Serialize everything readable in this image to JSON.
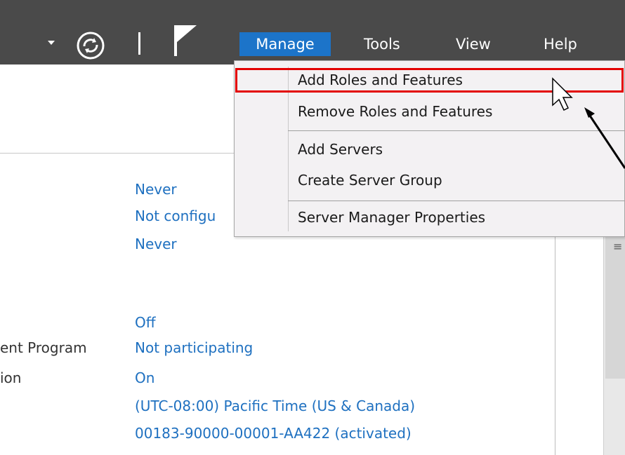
{
  "menubar": {
    "manage": "Manage",
    "tools": "Tools",
    "view": "View",
    "help": "Help"
  },
  "manage_menu": {
    "items": [
      "Add Roles and Features",
      "Remove Roles and Features",
      "Add Servers",
      "Create Server Group",
      "Server Manager Properties"
    ]
  },
  "properties": {
    "labels": [
      "ent Program",
      "ion"
    ],
    "values": [
      "Never",
      "Not configu",
      "Never",
      "Off",
      "Not participating",
      "On",
      "(UTC-08:00) Pacific Time (US & Canada)",
      "00183-90000-00001-AA422 (activated)"
    ]
  },
  "colors": {
    "titlebar": "#4a4a4a",
    "menu_selected": "#1c74c9",
    "link_blue": "#1e70c0",
    "highlight_box": "#e30000"
  },
  "icons": {
    "dropdown": "chevron-down-icon",
    "refresh": "refresh-icon",
    "flag": "notifications-flag-icon",
    "cursor": "mouse-pointer-icon"
  }
}
